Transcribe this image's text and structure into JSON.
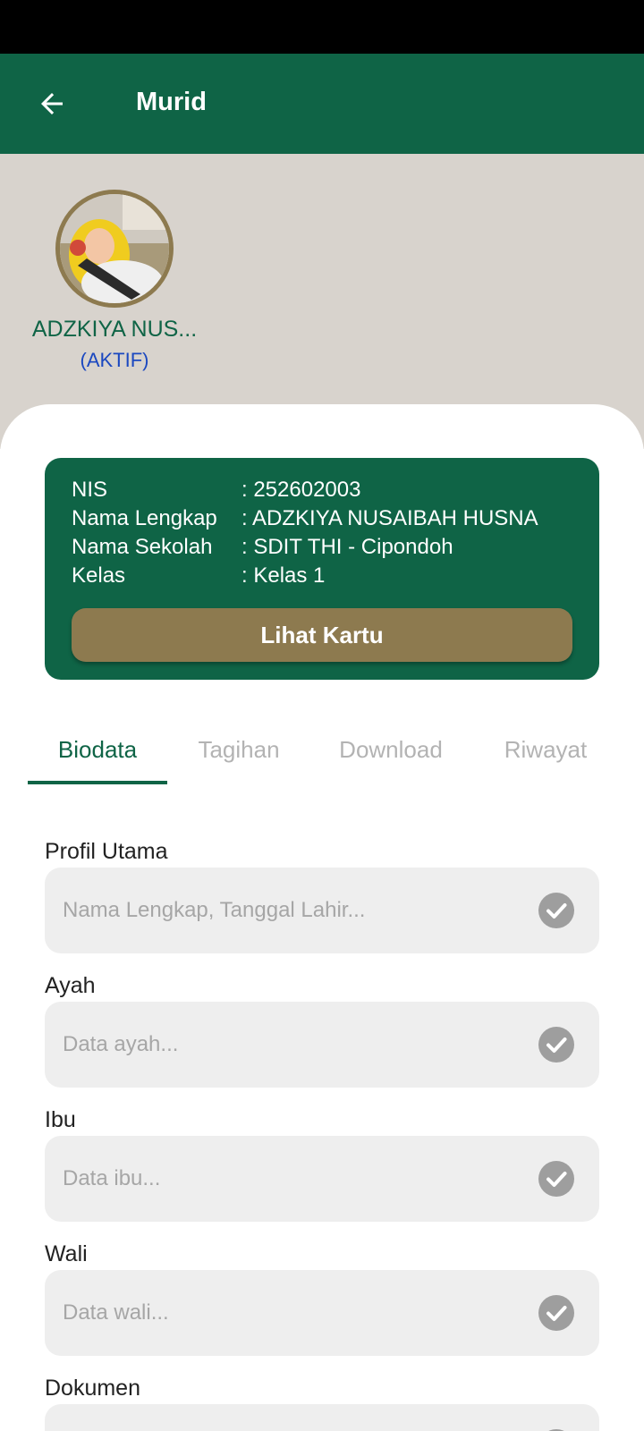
{
  "header": {
    "title": "Murid",
    "back_icon": "arrow-back-icon"
  },
  "profile": {
    "name": "ADZKIYA NUS...",
    "status": "(AKTIF)"
  },
  "card": {
    "rows": [
      {
        "label": "NIS",
        "value": ": 252602003"
      },
      {
        "label": "Nama Lengkap",
        "value": ": ADZKIYA NUSAIBAH HUSNA"
      },
      {
        "label": "Nama Sekolah",
        "value": ": SDIT THI - Cipondoh"
      },
      {
        "label": "Kelas",
        "value": ": Kelas 1"
      }
    ],
    "button_label": "Lihat Kartu"
  },
  "tabs": [
    {
      "label": "Biodata",
      "active": true
    },
    {
      "label": "Tagihan",
      "active": false
    },
    {
      "label": "Download",
      "active": false
    },
    {
      "label": "Riwayat",
      "active": false
    }
  ],
  "sections": [
    {
      "label": "Profil Utama",
      "placeholder": "Nama Lengkap, Tanggal Lahir...",
      "completed": true
    },
    {
      "label": "Ayah",
      "placeholder": "Data ayah...",
      "completed": true
    },
    {
      "label": "Ibu",
      "placeholder": "Data ibu...",
      "completed": true
    },
    {
      "label": "Wali",
      "placeholder": "Data wali...",
      "completed": true
    },
    {
      "label": "Dokumen",
      "placeholder": "",
      "completed": true
    }
  ],
  "colors": {
    "primary": "#0f6446",
    "accent": "#8d7a4f",
    "status": "#1b48c0",
    "background": "#d8d3cd"
  }
}
